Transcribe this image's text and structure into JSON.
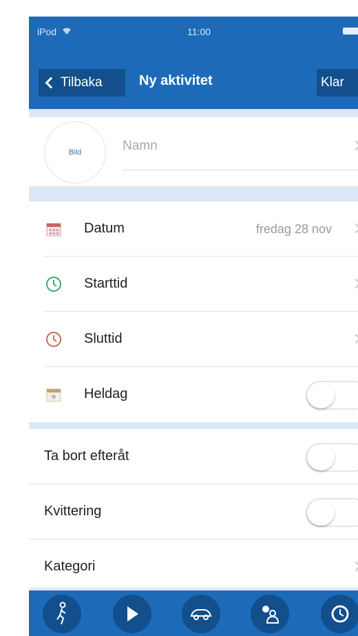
{
  "status": {
    "carrier": "iPod",
    "time": "11:00"
  },
  "nav": {
    "back_label": "Tilbaka",
    "title": "Ny aktivitet",
    "done_label": "Klar"
  },
  "name_section": {
    "photo_label": "Bild",
    "name_placeholder": "Namn"
  },
  "rows": {
    "date": {
      "label": "Datum",
      "value": "fredag 28 nov"
    },
    "start": {
      "label": "Starttid"
    },
    "end": {
      "label": "Sluttid"
    },
    "allday": {
      "label": "Heldag",
      "on": false
    },
    "remove_after": {
      "label": "Ta bort efteråt",
      "on": false
    },
    "receipt": {
      "label": "Kvittering",
      "on": false
    },
    "category": {
      "label": "Kategori"
    }
  },
  "tabs": [
    {
      "icon": "walking-person-icon"
    },
    {
      "icon": "bell-icon"
    },
    {
      "icon": "car-icon"
    },
    {
      "icon": "people-icon"
    },
    {
      "icon": "clock-icon"
    }
  ],
  "colors": {
    "primary": "#1d6bb8",
    "primary_dark": "#124f8c",
    "section_bg": "#dbe9f6"
  }
}
